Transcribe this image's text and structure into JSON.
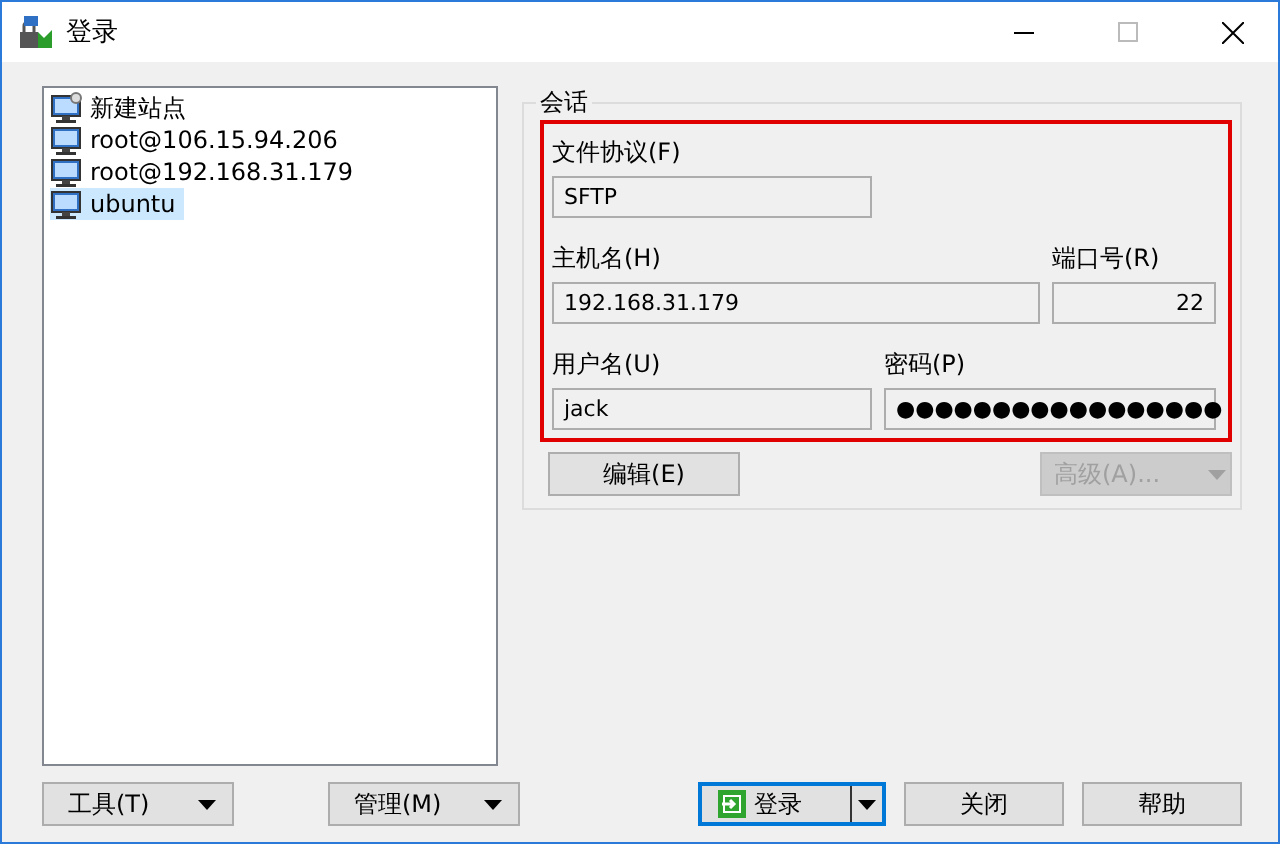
{
  "window": {
    "title": "登录"
  },
  "sites": [
    {
      "label": "新建站点",
      "kind": "new",
      "selected": false
    },
    {
      "label": "root@106.15.94.206",
      "kind": "site",
      "selected": false
    },
    {
      "label": "root@192.168.31.179",
      "kind": "site",
      "selected": false
    },
    {
      "label": "ubuntu",
      "kind": "site",
      "selected": true
    }
  ],
  "session": {
    "title": "会话",
    "protocol": {
      "label": "文件协议(F)",
      "value": "SFTP"
    },
    "host": {
      "label": "主机名(H)",
      "value": "192.168.31.179"
    },
    "port": {
      "label": "端口号(R)",
      "value": "22"
    },
    "user": {
      "label": "用户名(U)",
      "value": "jack"
    },
    "password": {
      "label": "密码(P)",
      "value": "●●●●●●●●●●●●●●●●●"
    },
    "edit_button": {
      "label": "编辑(E)",
      "disabled": false
    },
    "advanced_button": {
      "label": "高级(A)...",
      "disabled": true
    }
  },
  "left_buttons": [
    {
      "label": "工具(T)"
    },
    {
      "label": "管理(M)"
    }
  ],
  "login_button": {
    "label": "登录"
  },
  "buttons": [
    {
      "label": "关闭"
    },
    {
      "label": "帮助"
    }
  ]
}
